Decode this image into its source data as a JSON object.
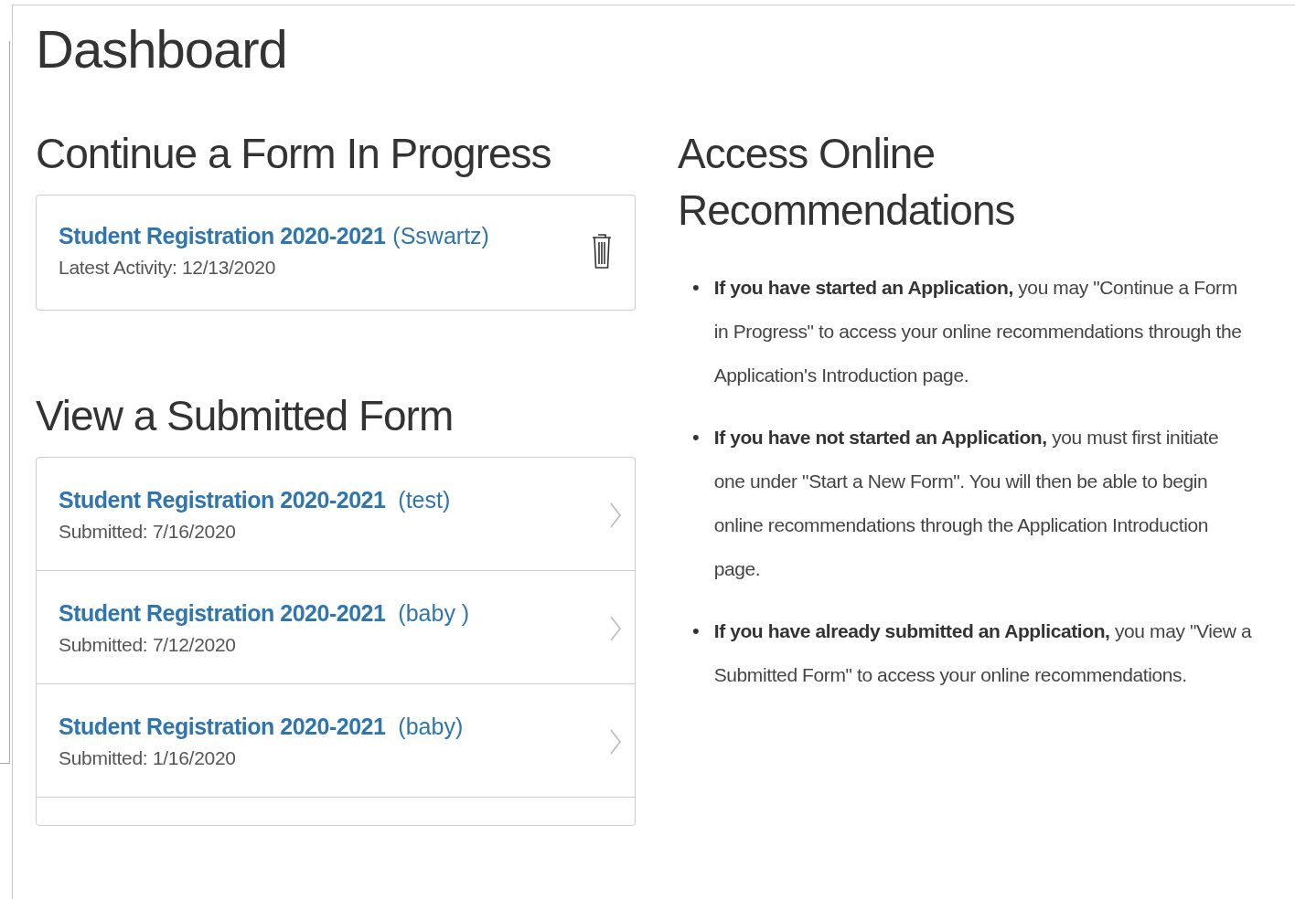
{
  "page_title": "Dashboard",
  "in_progress": {
    "heading": "Continue a Form In Progress",
    "forms": [
      {
        "title": "Student Registration 2020-2021",
        "tag": "(Sswartz)",
        "detail": "Latest Activity: 12/13/2020"
      }
    ]
  },
  "submitted": {
    "heading": "View a Submitted Form",
    "forms": [
      {
        "title": "Student Registration 2020-2021",
        "tag": "(test)",
        "detail": "Submitted: 7/16/2020"
      },
      {
        "title": "Student Registration 2020-2021",
        "tag": "(baby )",
        "detail": "Submitted: 7/12/2020"
      },
      {
        "title": "Student Registration 2020-2021",
        "tag": "(baby)",
        "detail": "Submitted: 1/16/2020"
      }
    ]
  },
  "recommendations": {
    "heading": "Access Online Recommendations",
    "bullets": [
      {
        "marker": "•",
        "text": "**If you have started an Application,** you may \"Continue a Form in Progress\" to access your online recommendations through the Application's Introduction page."
      },
      {
        "marker": "•",
        "text": "**If you have not started an Application,** you must first initiate one under \"Start a New Form\". You will then be able to begin online recommendations through the Application Introduction page."
      },
      {
        "marker": "•",
        "text": "**If you have already submitted an Application,** you may \"View a Submitted Form\" to access your online recommendations."
      }
    ]
  }
}
